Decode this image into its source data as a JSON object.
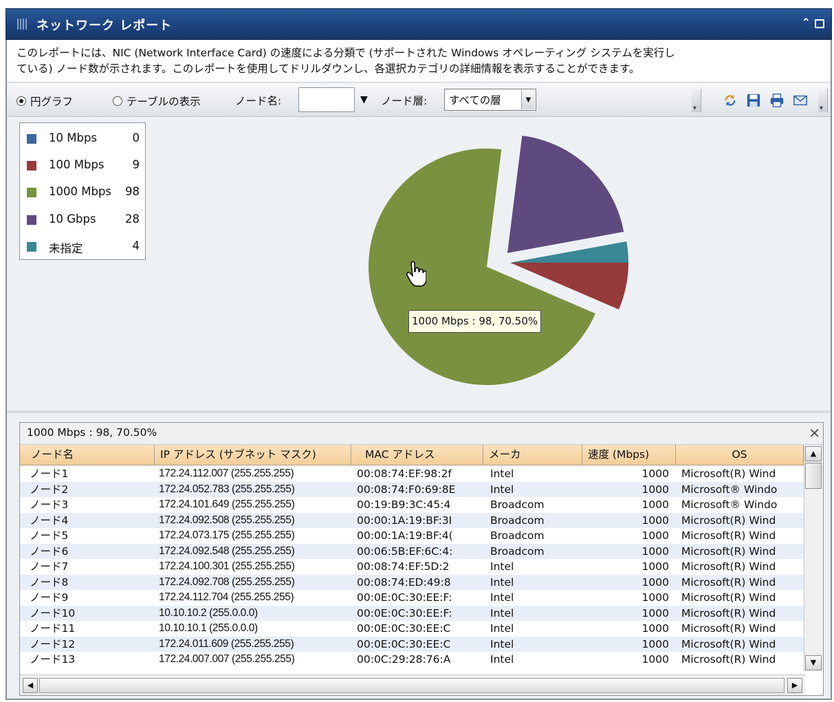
{
  "window": {
    "title": "ネットワーク レポート",
    "collapse_icon": "double-chevron-up-icon",
    "maximize_icon": "maximize-icon"
  },
  "description": {
    "line1": "このレポートには、NIC (Network Interface Card) の速度による分類で (サポートされた Windows オペレーティング システムを実行し",
    "line2": "ている) ノード数が示されます。このレポートを使用してドリルダウンし、各選択カテゴリの詳細情報を表示することができます。"
  },
  "toolbar": {
    "view_pie_label": "円グラフ",
    "view_pie_selected": true,
    "view_table_label": "テーブルの表示",
    "node_name_label": "ノード名:",
    "node_name_value": "",
    "node_tier_label": "ノード層:",
    "node_tier_value": "すべての層",
    "icons": [
      "refresh-icon",
      "save-icon",
      "print-icon",
      "email-icon"
    ]
  },
  "legend": [
    {
      "label": "10 Mbps",
      "count": "0",
      "color": "#3e68a0"
    },
    {
      "label": "100 Mbps",
      "count": "9",
      "color": "#963a3c"
    },
    {
      "label": "1000 Mbps",
      "count": "98",
      "color": "#7a9140"
    },
    {
      "label": "10 Gbps",
      "count": "28",
      "color": "#5f4a80"
    },
    {
      "label": "未指定",
      "count": "4",
      "color": "#3a8795"
    }
  ],
  "chart_data": {
    "type": "pie",
    "categories": [
      "10 Mbps",
      "100 Mbps",
      "1000 Mbps",
      "10 Gbps",
      "未指定"
    ],
    "values": [
      0,
      9,
      98,
      28,
      4
    ],
    "colors": [
      "#3e68a0",
      "#963a3c",
      "#7a9140",
      "#5f4a80",
      "#3a8795"
    ],
    "exploded": [
      "1000 Mbps",
      "10 Gbps"
    ],
    "legend": "top-left",
    "tooltip": "1000 Mbps : 98, 70.50%"
  },
  "grid": {
    "caption": "1000 Mbps : 98, 70.50%",
    "columns": [
      "ノード名",
      "IP アドレス (サブネット マスク)",
      "MAC アドレス",
      "メーカ",
      "速度 (Mbps)",
      "OS"
    ],
    "rows": [
      [
        "ノード1",
        "172.24.112.007 (255.255.255)",
        "00:08:74:EF:98:2f",
        "Intel",
        "1000",
        "Microsoft(R) Wind"
      ],
      [
        "ノード2",
        "172.24.052.783 (255.255.255)",
        "00:08:74:F0:69:8E",
        "Intel",
        "1000",
        "Microsoft® Windo"
      ],
      [
        "ノード3",
        "172.24.101.649 (255.255.255)",
        "00:19:B9:3C:45:4",
        "Broadcom",
        "1000",
        "Microsoft® Windo"
      ],
      [
        "ノード4",
        "172.24.092.508 (255.255.255)",
        "00:00:1A:19:BF:3I",
        "Broadcom",
        "1000",
        "Microsoft(R) Wind"
      ],
      [
        "ノード5",
        "172.24.073.175 (255.255.255)",
        "00:00:1A:19:BF:4(",
        "Broadcom",
        "1000",
        "Microsoft(R) Wind"
      ],
      [
        "ノード6",
        "172.24.092.548 (255.255.255)",
        "00:06:5B:EF:6C:4:",
        "Broadcom",
        "1000",
        "Microsoft(R) Wind"
      ],
      [
        "ノード7",
        "172.24.100.301 (255.255.255)",
        "00:08:74:EF:5D:2",
        "Intel",
        "1000",
        "Microsoft(R) Wind"
      ],
      [
        "ノード8",
        "172.24.092.708 (255.255.255)",
        "00:08:74:ED:49:8",
        "Intel",
        "1000",
        "Microsoft(R) Wind"
      ],
      [
        "ノード9",
        "172.24.112.704 (255.255.255)",
        "00:0E:0C:30:EE:F:",
        "Intel",
        "1000",
        "Microsoft(R) Wind"
      ],
      [
        "ノード10",
        "10.10.10.2 (255.0.0.0)",
        "00:0E:0C:30:EE:F:",
        "Intel",
        "1000",
        "Microsoft(R) Wind"
      ],
      [
        "ノード11",
        "10.10.10.1 (255.0.0.0)",
        "00:0E:0C:30:EE:C",
        "Intel",
        "1000",
        "Microsoft(R) Wind"
      ],
      [
        "ノード12",
        "172.24.011.609 (255.255.255)",
        "00:0E:0C:30:EE:C",
        "Intel",
        "1000",
        "Microsoft(R) Wind"
      ],
      [
        "ノード13",
        "172.24.007.007 (255.255.255)",
        "00:0C:29:28:76:A",
        "Intel",
        "1000",
        "Microsoft(R) Wind"
      ]
    ]
  }
}
